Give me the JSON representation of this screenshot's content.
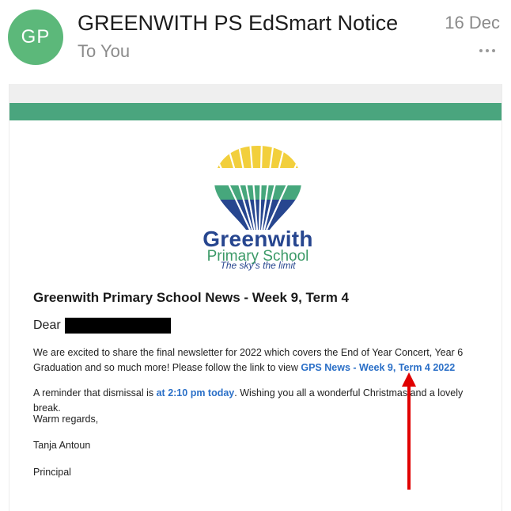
{
  "email": {
    "avatar_initials": "GP",
    "sender": "GREENWITH PS EdSmart Notice",
    "recipient": "To You",
    "date": "16 Dec"
  },
  "logo": {
    "school_name": "Greenwith",
    "school_sub": "Primary School",
    "tagline": "The sky's the limit"
  },
  "body": {
    "headline": "Greenwith Primary School News - Week 9, Term 4",
    "greeting": "Dear",
    "p1_text": "We are excited to share the final newsletter for 2022 which covers the End of Year Concert, Year 6 Graduation and so much more! Please follow the link to view ",
    "p1_link": "GPS News - Week 9, Term 4 2022",
    "p2_pre": "A reminder that dismissal is ",
    "p2_time": "at 2:10 pm today",
    "p2_post": ". Wishing you all a wonderful Christmas and a lovely break.",
    "closing": "Warm regards,",
    "signer_name": "Tanja Antoun",
    "signer_title": "Principal"
  },
  "colors": {
    "avatar": "#5cb87a",
    "green_bar": "#4aa57e",
    "link": "#2a6fc7",
    "annotation_arrow": "#e00000"
  }
}
